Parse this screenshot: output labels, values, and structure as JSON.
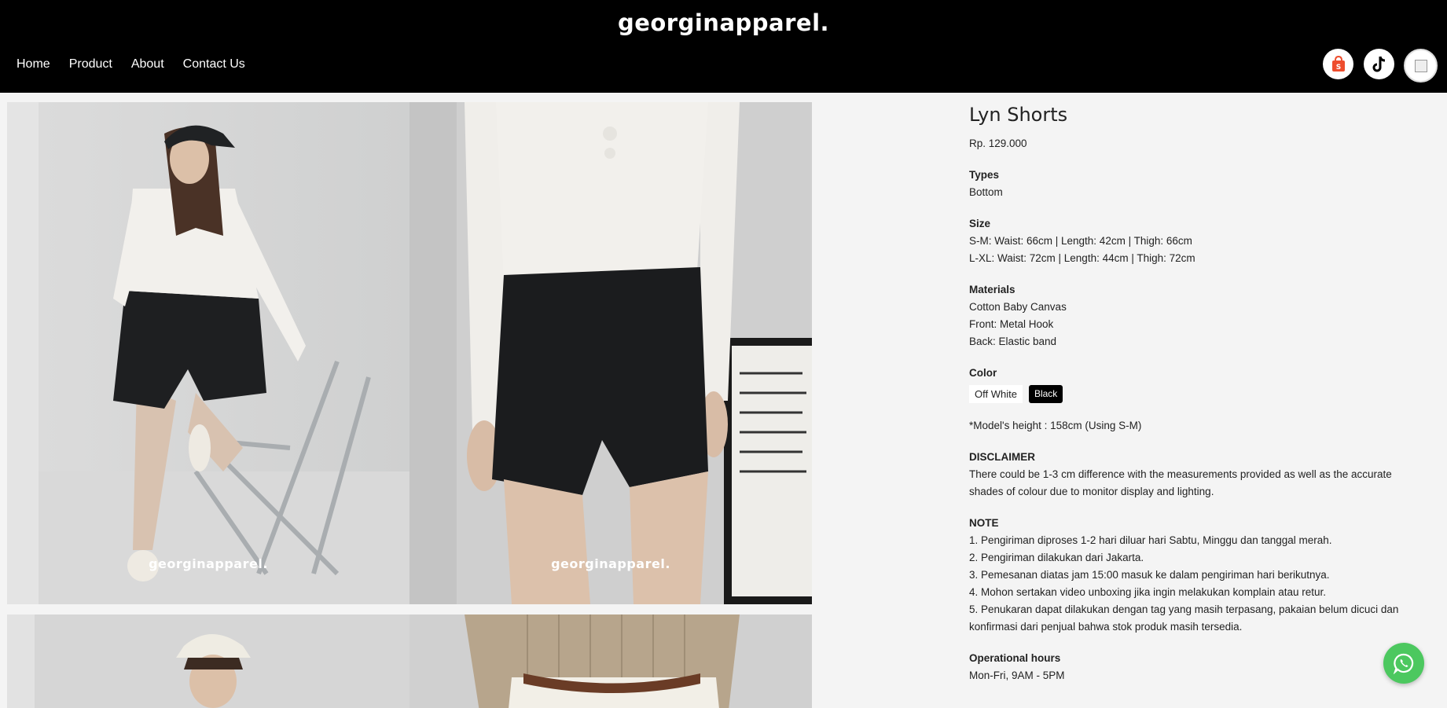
{
  "header": {
    "brand": "georginapparel.",
    "nav": [
      "Home",
      "Product",
      "About",
      "Contact Us"
    ],
    "social": [
      {
        "icon": "shopee-icon"
      },
      {
        "icon": "tiktok-icon"
      },
      {
        "icon": "broken-image-icon"
      }
    ]
  },
  "gallery": {
    "watermark": "georginapparel."
  },
  "product": {
    "title": "Lyn Shorts",
    "price": "Rp. 129.000",
    "types_label": "Types",
    "types_value": "Bottom",
    "size_label": "Size",
    "size_lines": [
      "S-M: Waist: 66cm | Length: 42cm | Thigh: 66cm",
      "L-XL: Waist: 72cm | Length: 44cm | Thigh: 72cm"
    ],
    "materials_label": "Materials",
    "materials_lines": [
      "Cotton Baby Canvas",
      "Front: Metal Hook",
      "Back: Elastic band"
    ],
    "color_label": "Color",
    "colors": [
      "Off White",
      "Black"
    ],
    "model_note": "*Model's height : 158cm (Using S-M)",
    "disclaimer_label": "DISCLAIMER",
    "disclaimer_text": "There could be 1-3 cm difference with the measurements provided as well as the accurate shades of colour due to monitor display and lighting.",
    "note_label": "NOTE",
    "note_lines": [
      "1. Pengiriman diproses 1-2 hari diluar hari Sabtu, Minggu dan tanggal merah.",
      "2. Pengiriman dilakukan dari Jakarta.",
      "3. Pemesanan diatas jam 15:00 masuk ke dalam pengiriman hari berikutnya.",
      "4. Mohon sertakan video unboxing jika ingin melakukan komplain atau retur.",
      "5. Penukaran dapat dilakukan dengan tag yang masih terpasang, pakaian belum dicuci dan konfirmasi dari penjual bahwa stok produk masih tersedia."
    ],
    "hours_label": "Operational hours",
    "hours_value": "Mon-Fri, 9AM - 5PM"
  },
  "colors": {
    "header_bg": "#000000",
    "page_bg": "#f4f4f4",
    "whatsapp": "#4cc85f"
  }
}
